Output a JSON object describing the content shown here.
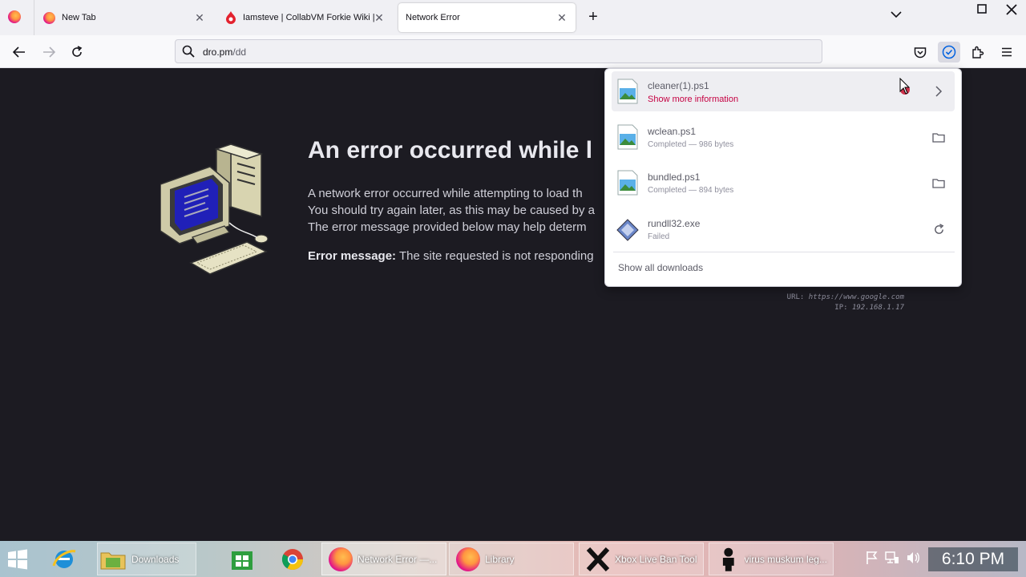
{
  "tabs": [
    {
      "title": "New Tab",
      "active": false
    },
    {
      "title": "Iamsteve | CollabVM Forkie Wiki | Fa",
      "active": false
    },
    {
      "title": "Network Error",
      "active": true
    }
  ],
  "address_bar": {
    "host": "dro.pm",
    "path": "/dd"
  },
  "error_page": {
    "title": "An error occurred while l",
    "lines": [
      "A network error occurred while attempting to load th",
      "You should try again later, as this may be caused by a",
      "The error message provided below may help determ"
    ],
    "message_label": "Error message:",
    "message_text": "The site requested is not responding",
    "diag_url_label": "URL:",
    "diag_url": "https://www.google.com",
    "diag_ip_label": "IP:",
    "diag_ip": "192.168.1.17"
  },
  "downloads": {
    "items": [
      {
        "name": "cleaner(1).ps1",
        "status": "Show more information",
        "action_icon": "chevron-right-icon"
      },
      {
        "name": "wclean.ps1",
        "status": "Completed — 986 bytes",
        "action_icon": "folder-icon"
      },
      {
        "name": "bundled.ps1",
        "status": "Completed — 894 bytes",
        "action_icon": "folder-icon"
      },
      {
        "name": "rundll32.exe",
        "status": "Failed",
        "action_icon": "retry-icon"
      }
    ],
    "show_all": "Show all downloads"
  },
  "taskbar": {
    "items": [
      {
        "label": "Downloads"
      },
      {
        "label": "Network Error —..."
      },
      {
        "label": "Library"
      },
      {
        "label": "Xbox Live Ban Tool"
      },
      {
        "label": "virus muskum leg..."
      }
    ],
    "clock": "6:10 PM"
  },
  "colors": {
    "warning": "#c50042",
    "page_bg": "#1c1b22"
  }
}
